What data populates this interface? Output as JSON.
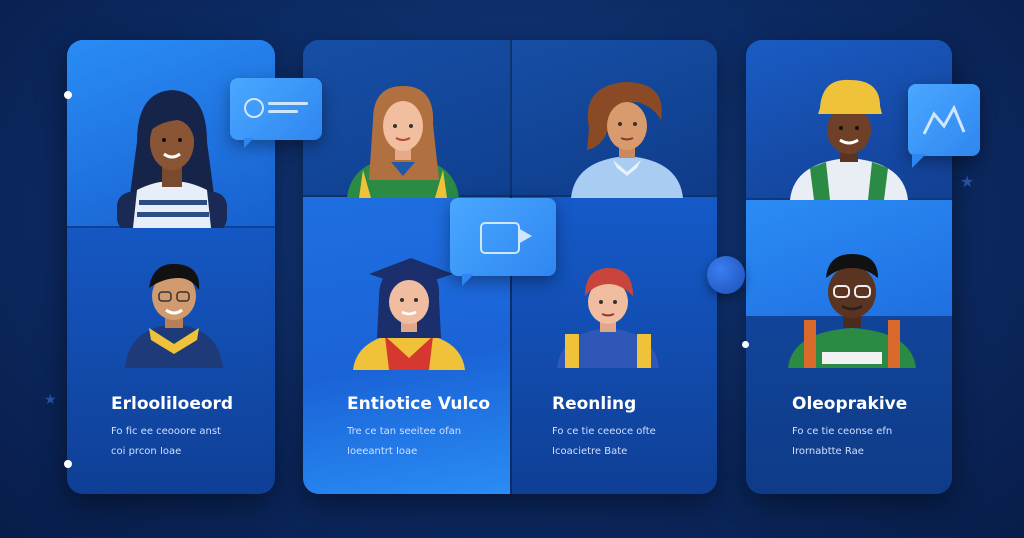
{
  "cards": [
    {
      "id": "left",
      "title": "Erlooliloeord",
      "lines": [
        "Fo fic ee ceooore anst",
        "coi prcon Ioae"
      ]
    },
    {
      "id": "mid-left",
      "title": "Entiotice Vulco",
      "lines": [
        "Tre ce tan seeitee ofan",
        "Ioeeantrt Ioae"
      ]
    },
    {
      "id": "mid-right",
      "title": "Reonling",
      "lines": [
        "Fo ce tie ceeoce ofte",
        "Icoacietre Bate"
      ]
    },
    {
      "id": "right",
      "title": "Oleoprakive",
      "lines": [
        "Fo ce tie ceonse efn",
        "Irornabtte Rae"
      ]
    }
  ],
  "colors": {
    "bg": "#0c2a63",
    "card": "#1558c4",
    "bubble": "#3b96f8"
  },
  "icons": [
    "chat-bubble-icon",
    "video-bubble-icon",
    "chart-bubble-icon",
    "star-icon",
    "dot-icon"
  ]
}
